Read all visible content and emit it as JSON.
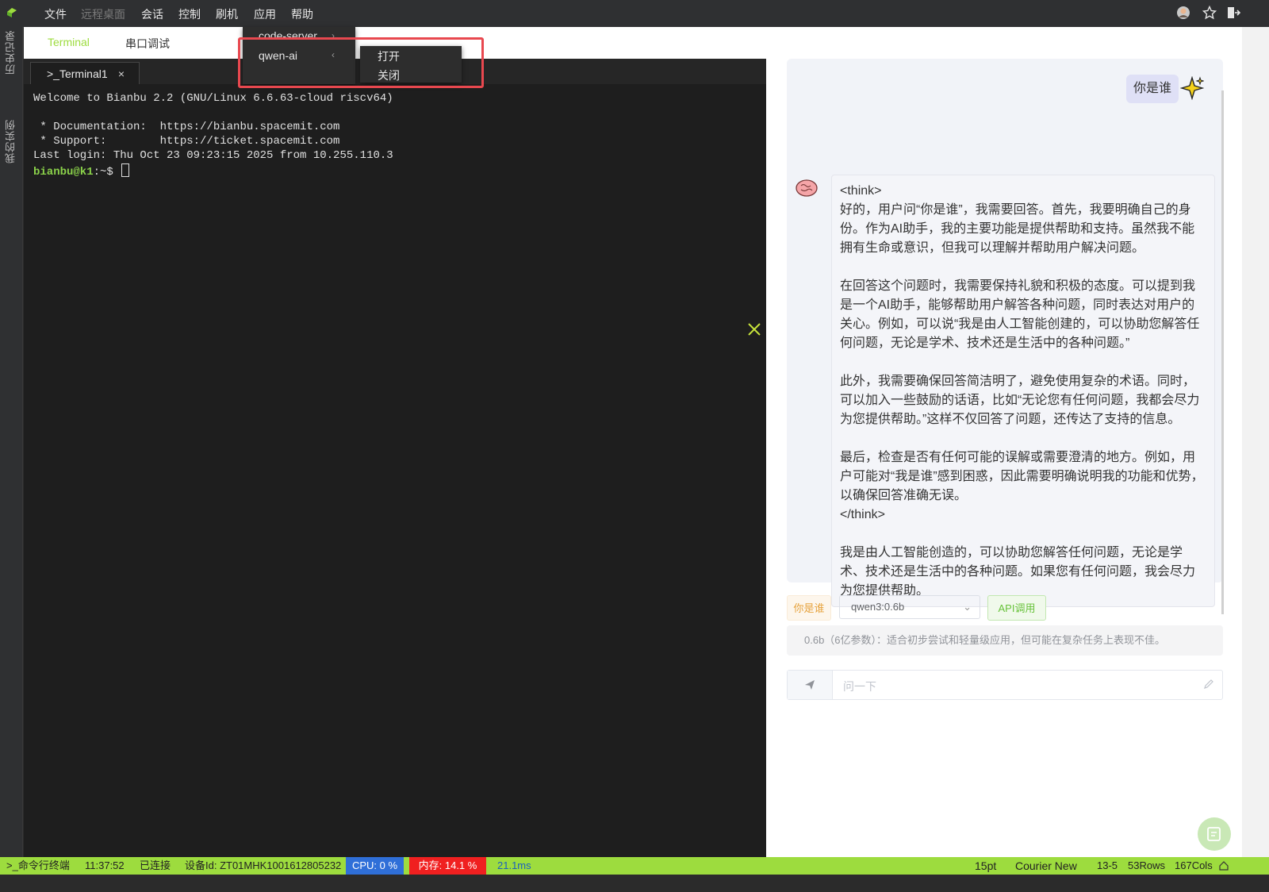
{
  "menubar": {
    "items": [
      "文件",
      "远程桌面",
      "会话",
      "控制",
      "刷机",
      "应用",
      "帮助"
    ]
  },
  "leftstrip": {
    "history": "历史记录",
    "instances": "我的实例"
  },
  "tabs": {
    "terminal": "Terminal",
    "serial": "串口调试"
  },
  "termtab": {
    "label": ">_Terminal1",
    "close": "×"
  },
  "terminal": {
    "lines": [
      "Welcome to Bianbu 2.2 (GNU/Linux 6.6.63-cloud riscv64)",
      "",
      " * Documentation:  https://bianbu.spacemit.com",
      " * Support:        https://ticket.spacemit.com",
      "Last login: Thu Oct 23 09:23:15 2025 from 10.255.110.3"
    ],
    "prompt": "bianbu@k1",
    "prompt_suffix": ":~$ "
  },
  "app_menu": {
    "items": [
      "code-server",
      "qwen-ai"
    ],
    "submenu": [
      "打开",
      "关闭"
    ]
  },
  "chat": {
    "user_message": "你是谁",
    "ai_paragraphs": [
      "<think>\n好的，用户问“你是谁”，我需要回答。首先，我要明确自己的身份。作为AI助手，我的主要功能是提供帮助和支持。虽然我不能拥有生命或意识，但我可以理解并帮助用户解决问题。",
      "在回答这个问题时，我需要保持礼貌和积极的态度。可以提到我是一个AI助手，能够帮助用户解答各种问题，同时表达对用户的关心。例如，可以说“我是由人工智能创建的，可以协助您解答任何问题，无论是学术、技术还是生活中的各种问题。”",
      "此外，我需要确保回答简洁明了，避免使用复杂的术语。同时，可以加入一些鼓励的话语，比如“无论您有任何问题，我都会尽力为您提供帮助。”这样不仅回答了问题，还传达了支持的信息。",
      "最后，检查是否有任何可能的误解或需要澄清的地方。例如，用户可能对“我是谁”感到困惑，因此需要明确说明我的功能和优势，以确保回答准确无误。\n</think>",
      "我是由人工智能创造的，可以协助您解答任何问题，无论是学术、技术还是生活中的各种问题。如果您有任何问题，我会尽力为您提供帮助。"
    ],
    "quick_chip": "你是谁",
    "model_select": "qwen3:0.6b",
    "api_button": "API调用",
    "model_info": "0.6b（6亿参数）：适合初步尝试和轻量级应用，但可能在复杂任务上表现不佳。",
    "input_placeholder": "问一下"
  },
  "statusbar": {
    "terminal_mode": ">_命令行终端",
    "time": "11:37:52",
    "connection": "已连接",
    "device_id": "设备Id: ZT01MHK1001612805232",
    "cpu": "CPU: 0 %",
    "memory": "内存: 14.1 %",
    "latency": "21.1ms",
    "font_size": "15pt",
    "font_name": "Courier New",
    "position": "13-5",
    "rows": "53Rows",
    "cols": "167Cols"
  },
  "colors": {
    "accent_green": "#9ddc3e",
    "cpu_bg": "#2f6fd8",
    "mem_bg": "#f02020",
    "highlight_red": "#e8484f"
  }
}
